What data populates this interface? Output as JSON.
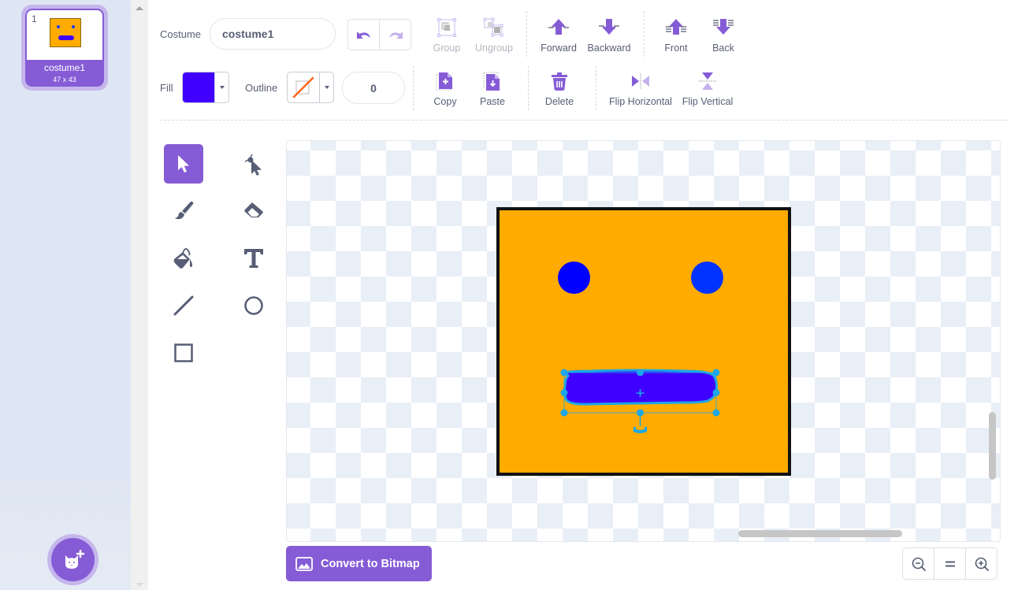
{
  "costume_list": {
    "items": [
      {
        "index": "1",
        "name": "costume1",
        "size": "47 x 43",
        "selected": true
      }
    ],
    "add_button_icon": "cat-plus-icon"
  },
  "toolbar": {
    "costume_label": "Costume",
    "costume_name": "costume1",
    "undo_icon": "undo-icon",
    "redo_icon": "redo-icon",
    "group": "Group",
    "ungroup": "Ungroup",
    "forward": "Forward",
    "backward": "Backward",
    "front": "Front",
    "back": "Back",
    "fill_label": "Fill",
    "fill_color": "#3f00ff",
    "outline_label": "Outline",
    "outline_color": "none",
    "outline_width": "0",
    "copy": "Copy",
    "paste": "Paste",
    "delete": "Delete",
    "flip_horizontal": "Flip Horizontal",
    "flip_vertical": "Flip Vertical"
  },
  "tools": [
    {
      "name": "select",
      "icon": "select-arrow-icon",
      "active": true
    },
    {
      "name": "reshape",
      "icon": "reshape-icon",
      "active": false
    },
    {
      "name": "brush",
      "icon": "brush-icon",
      "active": false
    },
    {
      "name": "eraser",
      "icon": "eraser-icon",
      "active": false
    },
    {
      "name": "fill",
      "icon": "fill-bucket-icon",
      "active": false
    },
    {
      "name": "text",
      "icon": "text-icon",
      "active": false
    },
    {
      "name": "line",
      "icon": "line-icon",
      "active": false
    },
    {
      "name": "circle",
      "icon": "circle-icon",
      "active": false
    },
    {
      "name": "rectangle",
      "icon": "rectangle-icon",
      "active": false
    }
  ],
  "canvas": {
    "costume_bg_color": "#ffab00",
    "left_eye_color": "#0000ff",
    "right_eye_color": "#0033ff",
    "mouth_color": "#3f00ff",
    "selection_color": "#1ca7e6"
  },
  "bottom": {
    "convert_button": "Convert to Bitmap",
    "zoom_out_icon": "zoom-out-icon",
    "zoom_reset_icon": "zoom-reset-icon",
    "zoom_in_icon": "zoom-in-icon"
  },
  "colors": {
    "accent": "#855cd6",
    "text": "#575e75"
  }
}
